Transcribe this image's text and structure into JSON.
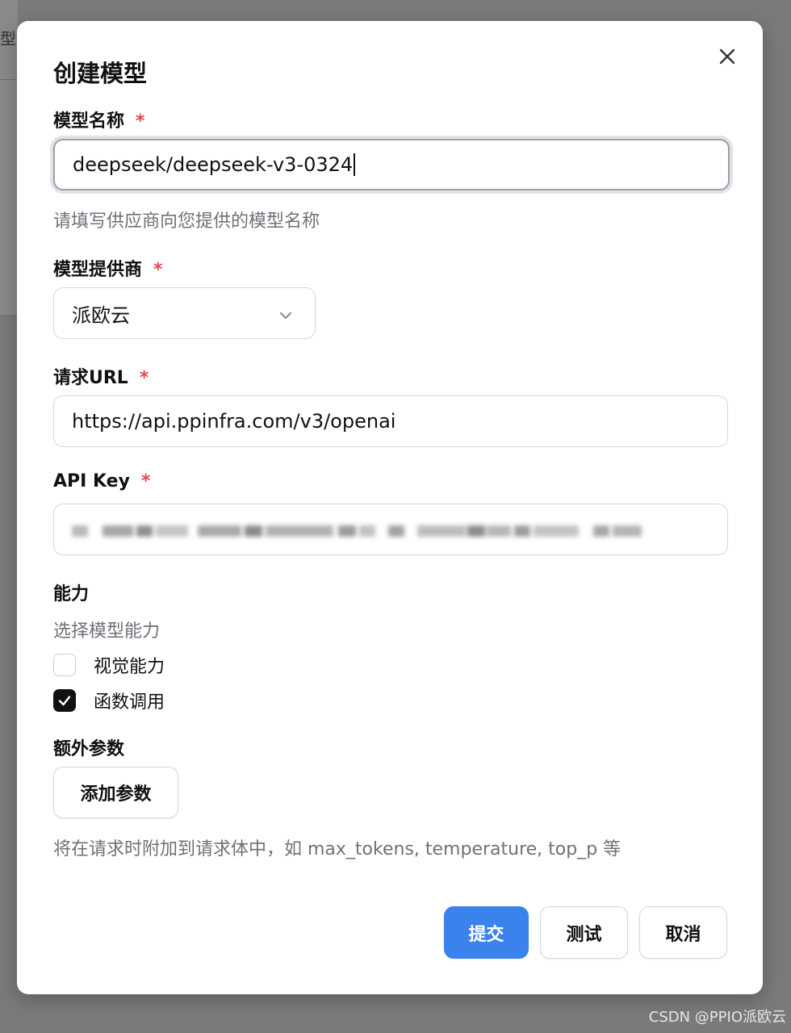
{
  "backdrop": {
    "fragment_text": "型"
  },
  "watermark": "CSDN @PPIO派欧云",
  "modal": {
    "title": "创建模型",
    "required_mark": "*",
    "model_name": {
      "label": "模型名称",
      "value": "deepseek/deepseek-v3-0324",
      "hint": "请填写供应商向您提供的模型名称"
    },
    "provider": {
      "label": "模型提供商",
      "selected": "派欧云"
    },
    "request_url": {
      "label": "请求URL",
      "value": "https://api.ppinfra.com/v3/openai"
    },
    "api_key": {
      "label": "API Key"
    },
    "capabilities": {
      "label": "能力",
      "hint": "选择模型能力",
      "options": [
        {
          "label": "视觉能力",
          "checked": false
        },
        {
          "label": "函数调用",
          "checked": true
        }
      ]
    },
    "extra_params": {
      "label": "额外参数",
      "add_button": "添加参数",
      "hint": "将在请求时附加到请求体中，如 max_tokens, temperature, top_p 等"
    },
    "footer": {
      "submit": "提交",
      "test": "测试",
      "cancel": "取消"
    }
  },
  "colors": {
    "primary": "#3b82ec",
    "required": "#e5484d",
    "checkbox_checked": "#111111"
  }
}
